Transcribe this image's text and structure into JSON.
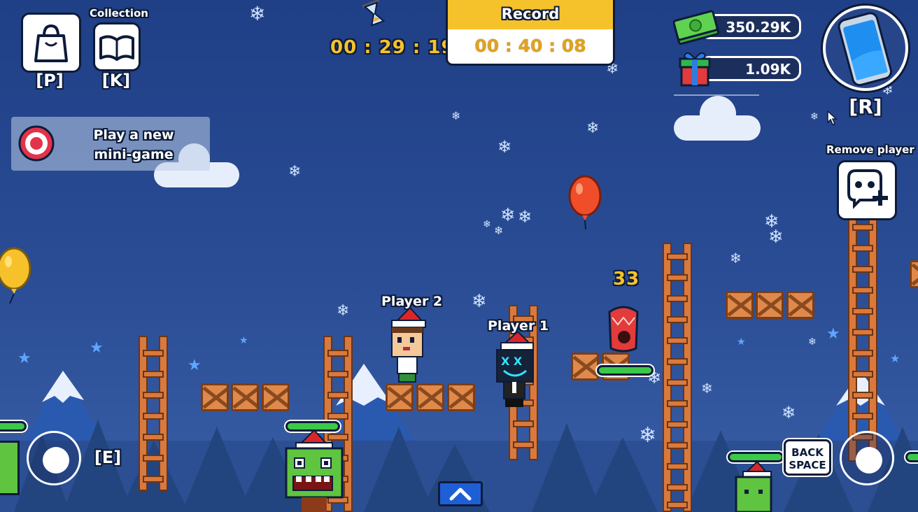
{
  "hud": {
    "shop_key": "[P]",
    "collection_label": "Collection",
    "collection_key": "[K]",
    "timer": "00 : 29 : 19",
    "record_label": "Record",
    "record_time": "00 : 40 : 08",
    "money": "350.29K",
    "gifts": "1.09K",
    "phone_key": "[R]",
    "remove_player_label": "Remove player"
  },
  "mission": {
    "line1": "Play a new",
    "line2": "mini-game"
  },
  "game": {
    "player2_name": "Player 2",
    "player1_name": "Player 1",
    "hit_count": "33"
  },
  "controls": {
    "left_key": "[E]",
    "backspace_line1": "BACK",
    "backspace_line2": "SPACE"
  },
  "colors": {
    "sky": "#2a4d95",
    "accent_yellow": "#f6c22b",
    "health_green": "#3cc94a",
    "crate": "#e0894a"
  }
}
